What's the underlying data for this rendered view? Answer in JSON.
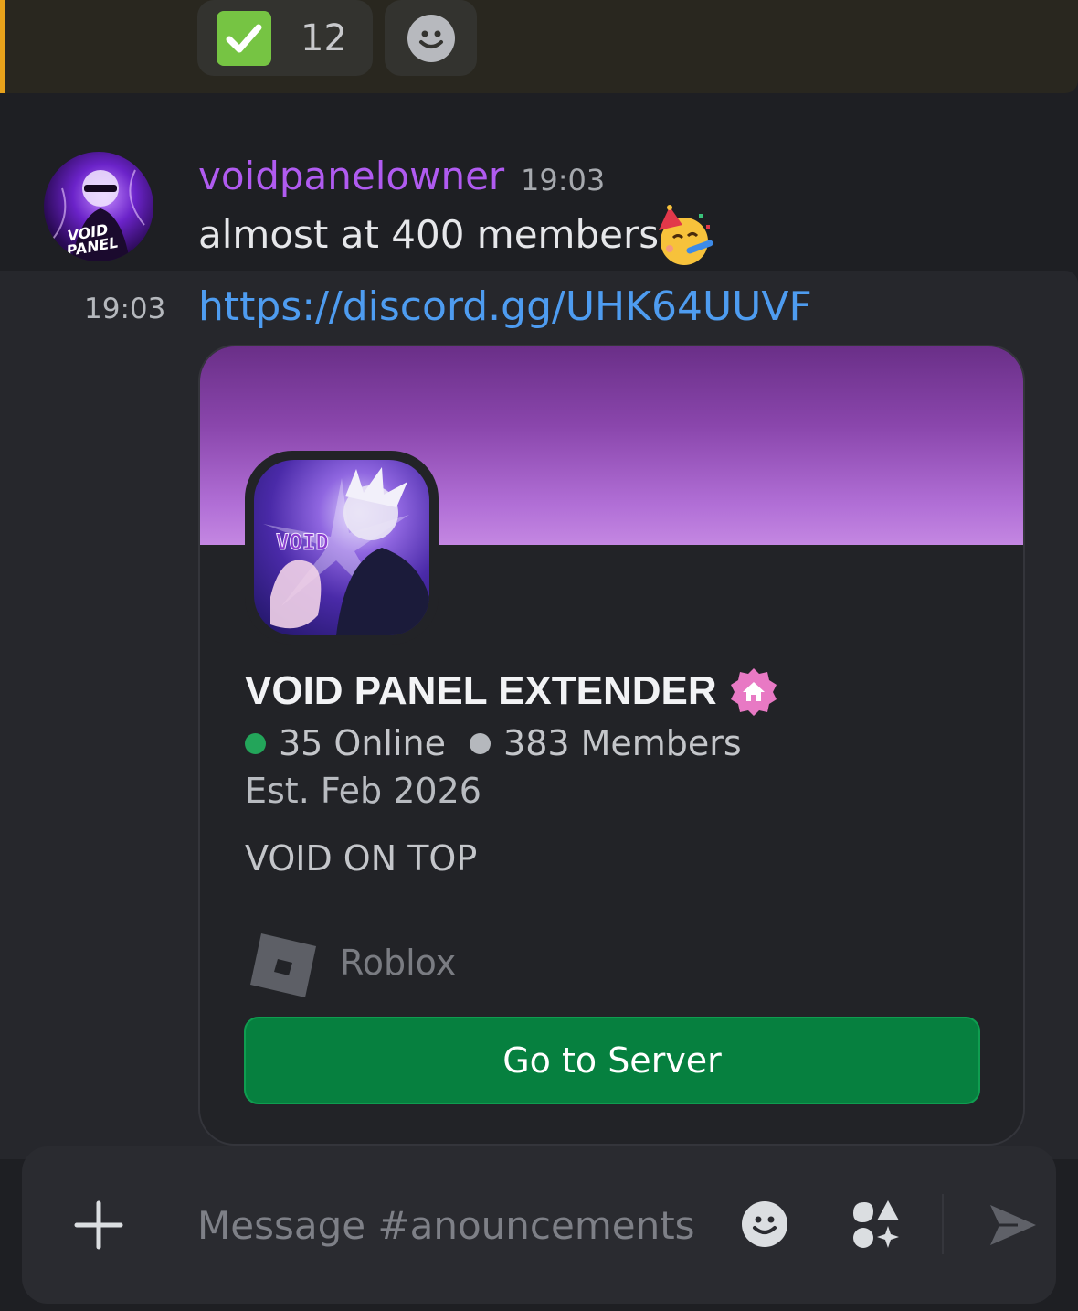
{
  "previous_message": {
    "reactions": [
      {
        "emoji_icon": "white-check-mark-icon",
        "count": "12"
      }
    ],
    "add_reaction_icon": "smile-add-icon",
    "accent_color": "#e8a21b"
  },
  "message": {
    "username": "voidpanelowner",
    "username_color": "#b05bf0",
    "time": "19:03",
    "text": "almost at 400 members",
    "emoji_icon": "partying-face-icon"
  },
  "followup": {
    "time": "19:03",
    "link": "https://discord.gg/UHK64UUVF"
  },
  "invite_card": {
    "server_name": "VOID PANEL EXTENDER",
    "badge_icon": "home-badge-icon",
    "online": "35 Online",
    "members": "383 Members",
    "established": "Est. Feb 2026",
    "description": "VOID ON TOP",
    "game": "Roblox",
    "button_label": "Go to Server",
    "button_color": "#06803f"
  },
  "composer": {
    "placeholder": "Message #anouncements"
  }
}
